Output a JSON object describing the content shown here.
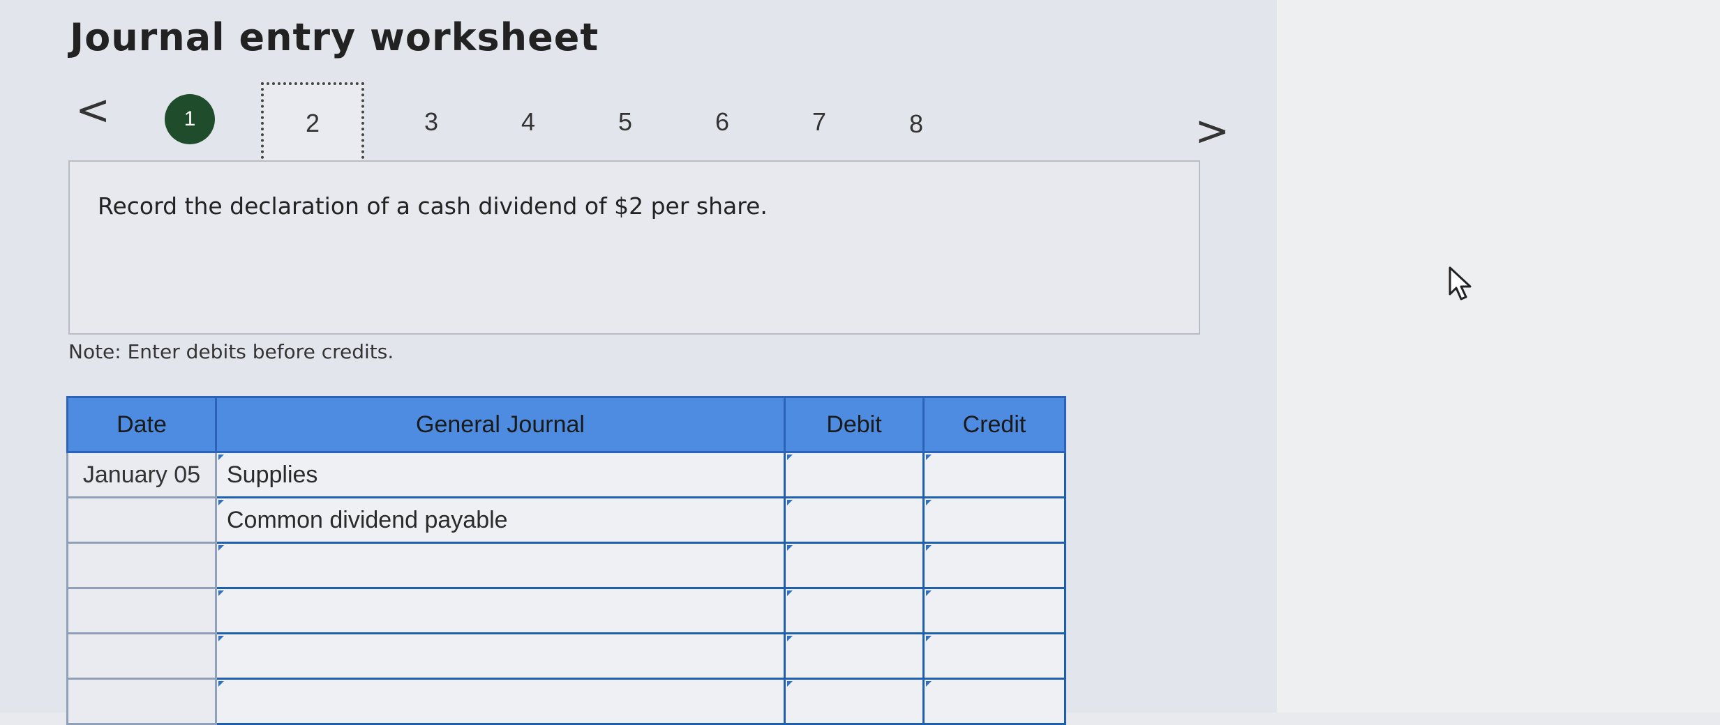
{
  "title": "Journal entry worksheet",
  "nav": {
    "prev_symbol": "<",
    "next_symbol": ">",
    "steps": [
      "1",
      "2",
      "3",
      "4",
      "5",
      "6",
      "7",
      "8"
    ],
    "completed_step": "1",
    "active_step": "2"
  },
  "instruction": "Record the declaration of a cash dividend of $2 per share.",
  "note": "Note: Enter debits before credits.",
  "table": {
    "headers": {
      "date": "Date",
      "journal": "General Journal",
      "debit": "Debit",
      "credit": "Credit"
    },
    "rows": [
      {
        "date": "January 05",
        "account": "Supplies",
        "debit": "",
        "credit": ""
      },
      {
        "date": "",
        "account": "Common dividend payable",
        "debit": "",
        "credit": ""
      },
      {
        "date": "",
        "account": "",
        "debit": "",
        "credit": ""
      },
      {
        "date": "",
        "account": "",
        "debit": "",
        "credit": ""
      },
      {
        "date": "",
        "account": "",
        "debit": "",
        "credit": ""
      },
      {
        "date": "",
        "account": "",
        "debit": "",
        "credit": ""
      }
    ]
  },
  "colors": {
    "header_blue": "#4d8ce0",
    "input_border": "#1f5fae",
    "completed_step_green": "#1f4d2c"
  },
  "icons": {
    "cursor": "mouse-pointer-icon"
  }
}
